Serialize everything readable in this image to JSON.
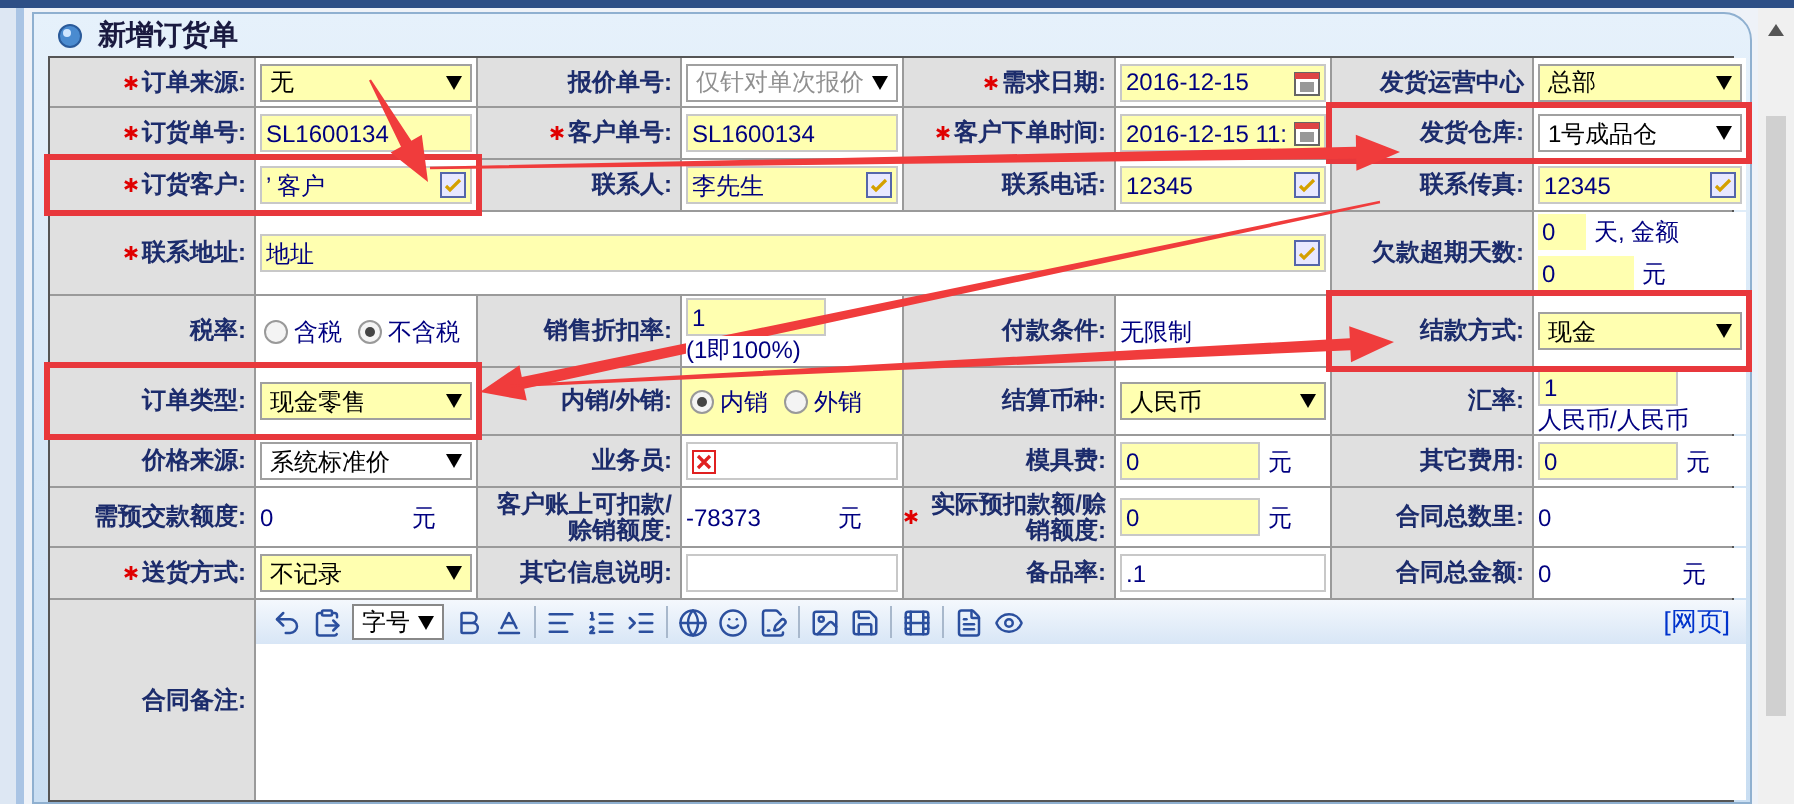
{
  "window": {
    "title": "新增订货单"
  },
  "form": {
    "rows": [
      {
        "cells": [
          {
            "label": "订单来源:",
            "required": true,
            "boxed": false,
            "field": {
              "kind": "select",
              "value": "无",
              "yellow": true,
              "disabled": false
            }
          },
          {
            "label": "报价单号:",
            "required": false,
            "boxed": false,
            "field": {
              "kind": "select",
              "value": "仅针对单次报价",
              "yellow": false,
              "disabled": true
            }
          },
          {
            "label": "需求日期:",
            "required": true,
            "boxed": false,
            "field": {
              "kind": "date",
              "value": "2016-12-15",
              "yellow": true
            }
          },
          {
            "label": "发货运营中心",
            "required": false,
            "boxed": false,
            "field": {
              "kind": "select",
              "value": "总部",
              "yellow": true,
              "disabled": false
            }
          }
        ]
      },
      {
        "cells": [
          {
            "label": "订货单号:",
            "required": true,
            "boxed": false,
            "field": {
              "kind": "input",
              "value": "SL1600134",
              "yellow": true
            }
          },
          {
            "label": "客户单号:",
            "required": true,
            "boxed": false,
            "field": {
              "kind": "input",
              "value": "SL1600134",
              "yellow": true
            }
          },
          {
            "label": "客户下单时间:",
            "required": true,
            "boxed": false,
            "field": {
              "kind": "date",
              "value": "2016-12-15 11:",
              "yellow": true
            }
          },
          {
            "label": "发货仓库:",
            "required": false,
            "boxed": true,
            "field": {
              "kind": "select",
              "value": "1号成品仓",
              "yellow": false,
              "disabled": false
            }
          }
        ]
      },
      {
        "cells": [
          {
            "label": "订货客户:",
            "required": true,
            "boxed": true,
            "field": {
              "kind": "lookup",
              "value": "’ 客户",
              "yellow": true
            }
          },
          {
            "label": "联系人:",
            "required": false,
            "boxed": false,
            "field": {
              "kind": "lookup",
              "value": "李先生",
              "yellow": true
            }
          },
          {
            "label": "联系电话:",
            "required": false,
            "boxed": false,
            "field": {
              "kind": "lookup",
              "value": "12345",
              "yellow": true
            }
          },
          {
            "label": "联系传真:",
            "required": false,
            "boxed": false,
            "field": {
              "kind": "lookup",
              "value": "12345",
              "yellow": true
            }
          }
        ]
      },
      {
        "cells": [
          {
            "label": "联系地址:",
            "required": true,
            "boxed": false,
            "field": {
              "kind": "lookup",
              "value": "地址",
              "yellow": true
            }
          },
          "",
          "",
          {
            "label": "欠款超期天数:",
            "required": false,
            "boxed": false,
            "field": {
              "kind": "pair",
              "parts": [
                {
                  "value": "0",
                  "suffix": "天, 金额"
                },
                {
                  "value": "0",
                  "suffix": "元"
                }
              ]
            }
          }
        ]
      },
      {
        "cells": [
          {
            "label": "税率:",
            "required": false,
            "boxed": false,
            "field": {
              "kind": "radio",
              "yellow": false,
              "options": [
                {
                  "label": "含税",
                  "selected": false
                },
                {
                  "label": "不含税",
                  "selected": true
                }
              ]
            }
          },
          {
            "label": "销售折扣率:",
            "required": false,
            "boxed": false,
            "field": {
              "kind": "input",
              "value": "1",
              "yellow": true,
              "suffix": "(1即100%)"
            }
          },
          {
            "label": "付款条件:",
            "required": false,
            "boxed": false,
            "field": {
              "kind": "text",
              "value": "无限制"
            }
          },
          {
            "label": "结款方式:",
            "required": false,
            "boxed": true,
            "field": {
              "kind": "select",
              "value": "现金",
              "yellow": true,
              "disabled": false
            }
          }
        ]
      },
      {
        "cells": [
          {
            "label": "订单类型:",
            "required": false,
            "boxed": true,
            "field": {
              "kind": "select",
              "value": "现金零售",
              "yellow": true,
              "disabled": false
            }
          },
          {
            "label": "内销/外销:",
            "required": false,
            "boxed": false,
            "field": {
              "kind": "radio",
              "yellow": true,
              "options": [
                {
                  "label": "内销",
                  "selected": true
                },
                {
                  "label": "外销",
                  "selected": false
                }
              ]
            }
          },
          {
            "label": "结算币种:",
            "required": false,
            "boxed": false,
            "field": {
              "kind": "select",
              "value": "人民币",
              "yellow": true,
              "disabled": false
            }
          },
          {
            "label": "汇率:",
            "required": false,
            "boxed": false,
            "field": {
              "kind": "input",
              "value": "1",
              "yellow": true,
              "suffix": "人民币/人民币"
            }
          }
        ]
      },
      {
        "cells": [
          {
            "label": "价格来源:",
            "required": false,
            "boxed": false,
            "field": {
              "kind": "select",
              "value": "系统标准价",
              "yellow": false,
              "disabled": false
            }
          },
          {
            "label": "业务员:",
            "required": false,
            "boxed": false,
            "field": {
              "kind": "picker",
              "yellow": false
            }
          },
          {
            "label": "模具费:",
            "required": false,
            "boxed": false,
            "field": {
              "kind": "input",
              "value": "0",
              "yellow": true,
              "suffix": "元"
            }
          },
          {
            "label": "其它费用:",
            "required": false,
            "boxed": false,
            "field": {
              "kind": "input",
              "value": "0",
              "yellow": true,
              "suffix": "元"
            }
          }
        ]
      },
      {
        "cells": [
          {
            "label": "需预交款额度:",
            "required": false,
            "boxed": false,
            "field": {
              "kind": "text",
              "value": "0",
              "suffix": "元"
            }
          },
          {
            "label": "客户账上可扣款/赊销额度:",
            "required": false,
            "boxed": false,
            "field": {
              "kind": "text",
              "value": "-78373",
              "suffix": "元"
            }
          },
          {
            "label": "实际预扣款额/赊销额度:",
            "required": true,
            "boxed": false,
            "field": {
              "kind": "input",
              "value": "0",
              "yellow": true,
              "suffix": "元"
            }
          },
          {
            "label": "合同总数里:",
            "required": false,
            "boxed": false,
            "field": {
              "kind": "text",
              "value": "0"
            }
          }
        ]
      },
      {
        "cells": [
          {
            "label": "送货方式:",
            "required": true,
            "boxed": false,
            "field": {
              "kind": "select",
              "value": "不记录",
              "yellow": true,
              "disabled": false
            }
          },
          {
            "label": "其它信息说明:",
            "required": false,
            "boxed": false,
            "field": {
              "kind": "input",
              "yellow": false
            }
          },
          {
            "label": "备品率:",
            "required": false,
            "boxed": false,
            "field": {
              "kind": "input",
              "value": ".1",
              "yellow": false
            }
          },
          {
            "label": "合同总金额:",
            "required": false,
            "boxed": false,
            "field": {
              "kind": "text",
              "value": "0",
              "suffix": "元"
            }
          }
        ]
      },
      {
        "cells": [
          {
            "label": "合同备注:",
            "required": false,
            "boxed": false,
            "field": {
              "kind": "editor",
              "font_size_select": "字号",
              "link": "[网页]"
            }
          },
          "",
          "",
          ""
        ]
      }
    ]
  }
}
